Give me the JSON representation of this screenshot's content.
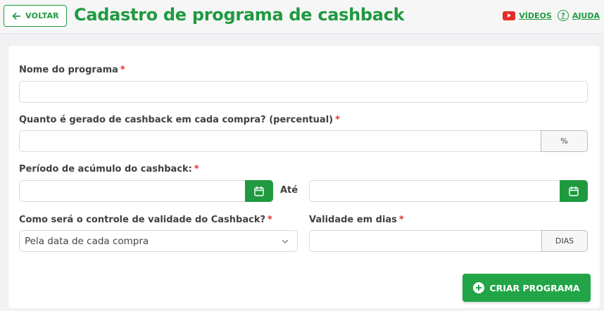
{
  "header": {
    "back_label": "VOLTAR",
    "title": "Cadastro de programa de cashback",
    "videos_label": "VÍDEOS",
    "help_label": "AJUDA",
    "help_glyph": "?"
  },
  "form": {
    "program_name": {
      "label": "Nome do programa",
      "required": "*",
      "value": ""
    },
    "cashback_percent": {
      "label": "Quanto é gerado de cashback em cada compra? (percentual)",
      "required": "*",
      "value": "",
      "addon": "%"
    },
    "period": {
      "label": "Período de acúmulo do cashback:",
      "required": "*",
      "start": "",
      "separator": "Até",
      "end": ""
    },
    "validity_control": {
      "label": "Como será o controle de validade do Cashback?",
      "required": "*",
      "selected": "Pela data de cada compra"
    },
    "validity_days": {
      "label": "Validade em dias",
      "required": "*",
      "value": "",
      "addon": "DIAS"
    }
  },
  "actions": {
    "create_label": "CRIAR PROGRAMA"
  },
  "colors": {
    "accent": "#1f9a3f",
    "required": "#e0312f",
    "youtube": "#e52d27"
  },
  "icons": [
    "arrow-left-icon",
    "youtube-icon",
    "help-circle-icon",
    "calendar-icon",
    "chevron-down-icon",
    "plus-circle-icon"
  ]
}
